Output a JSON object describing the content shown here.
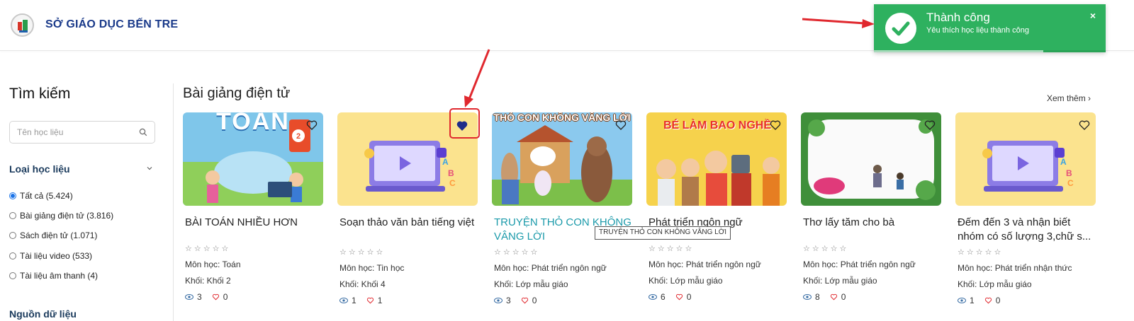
{
  "header": {
    "brand": "SỞ GIÁO DỤC BẾN TRE",
    "logo_icon": "school-logo-icon"
  },
  "sidebar": {
    "title": "Tìm kiếm",
    "search": {
      "placeholder": "Tên học liệu",
      "value": ""
    },
    "filter": {
      "title": "Loại học liệu",
      "options": [
        {
          "label": "Tất cả (5.424)",
          "selected": true
        },
        {
          "label": "Bài giảng điện tử (3.816)",
          "selected": false
        },
        {
          "label": "Sách điện tử (1.071)",
          "selected": false
        },
        {
          "label": "Tài liệu video (533)",
          "selected": false
        },
        {
          "label": "Tài liệu âm thanh (4)",
          "selected": false
        }
      ]
    },
    "filter2": {
      "title": "Nguồn dữ liệu"
    }
  },
  "section": {
    "title": "Bài giảng điện tử",
    "see_more": "Xem thêm ›"
  },
  "cards": [
    {
      "title": "BÀI TOÁN NHIỀU HƠN",
      "thumb_text": "TOÁN",
      "subject": "Môn học: Toán",
      "grade": "Khối: Khối 2",
      "views": "3",
      "likes": "0",
      "liked": false
    },
    {
      "title": "Soạn thảo văn bản tiếng việt",
      "subject": "Môn học: Tin học",
      "grade": "Khối: Khối 4",
      "views": "1",
      "likes": "1",
      "liked": true
    },
    {
      "title": "TRUYỆN THỎ CON KHÔNG VÂNG LỜI",
      "thumb_text": "THỎ CON KHÔNG VÂNG LỜI",
      "subject": "Môn học: Phát triển ngôn ngữ",
      "grade": "Khối: Lớp mẫu giáo",
      "views": "3",
      "likes": "0",
      "liked": false
    },
    {
      "title": "Phát triển ngôn ngữ",
      "thumb_text": "BÉ LÀM BAO NGHỀ",
      "subject": "Môn học: Phát triển ngôn ngữ",
      "grade": "Khối: Lớp mẫu giáo",
      "views": "6",
      "likes": "0",
      "liked": false
    },
    {
      "title": "Thơ lấy tăm cho bà",
      "subject": "Môn học: Phát triển ngôn ngữ",
      "grade": "Khối: Lớp mẫu giáo",
      "views": "8",
      "likes": "0",
      "liked": false
    },
    {
      "title": "Đếm đến 3 và nhận biết nhóm có số lượng 3,chữ s...",
      "subject": "Môn học: Phát triển nhận thức",
      "grade": "Khối: Lớp mẫu giáo",
      "views": "1",
      "likes": "0",
      "liked": false
    }
  ],
  "stars_text": "☆☆☆☆☆",
  "tooltip": "TRUYỆN THỎ CON KHÔNG VÂNG LỜI",
  "toast": {
    "title": "Thành công",
    "message": "Yêu thích học liệu thành công",
    "close": "×",
    "progress": 0.73,
    "color": "#2eb15f"
  },
  "colors": {
    "accent": "#1a73e8",
    "brand": "#1a3a8a",
    "link": "#1b9aaa",
    "like": "#e0282e",
    "annotation": "#e0282e"
  }
}
